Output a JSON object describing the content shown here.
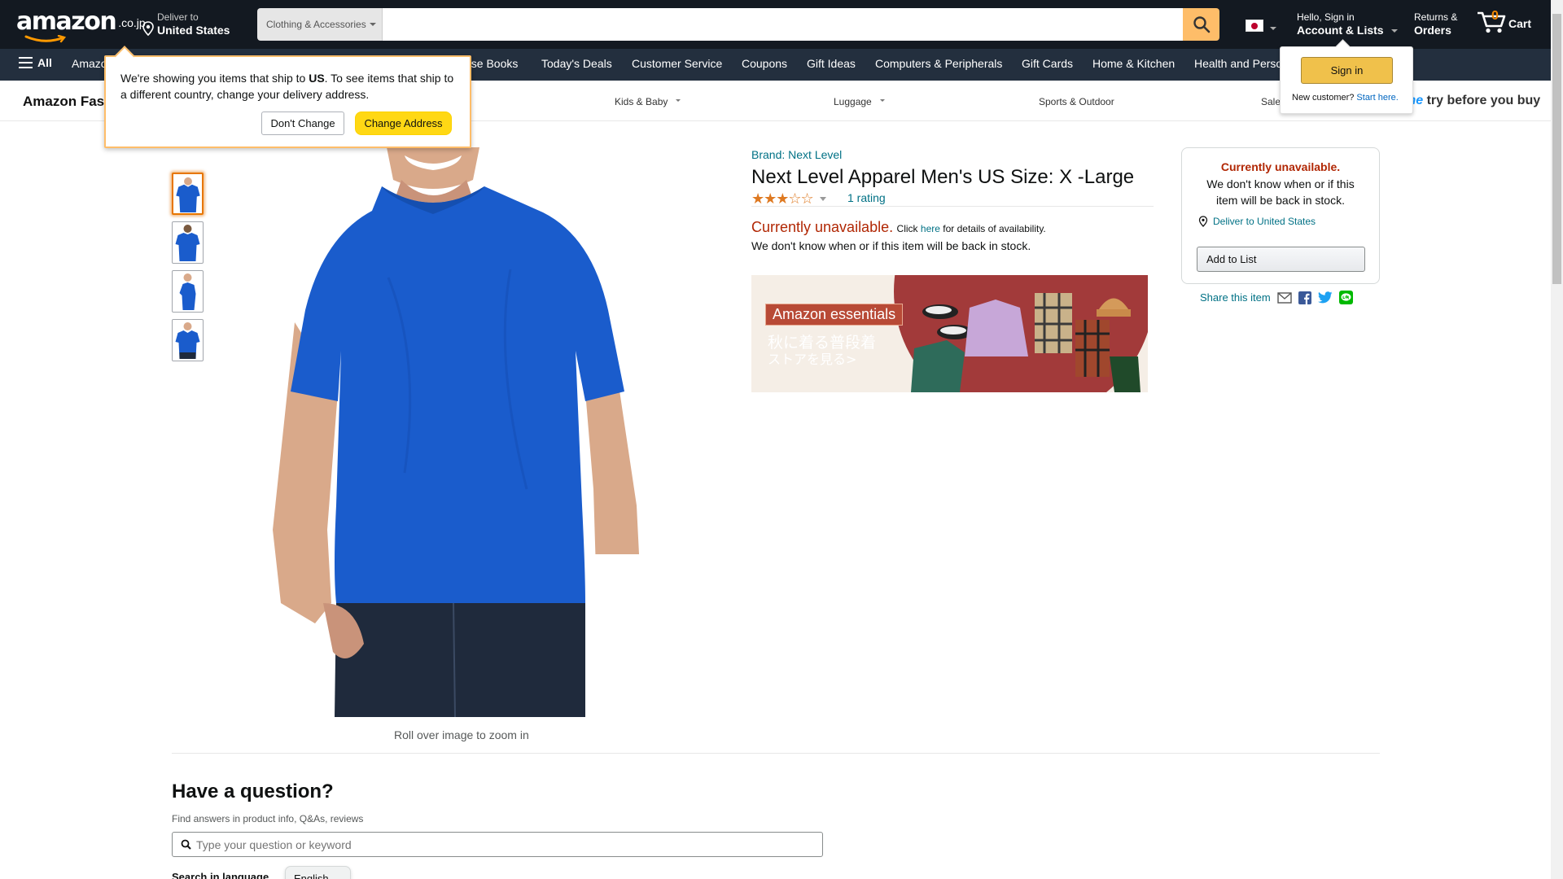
{
  "header": {
    "logo_text": "amazon",
    "logo_tld": ".co.jp",
    "deliver_label": "Deliver to",
    "deliver_location": "United States",
    "search_category": "Clothing & Accessories",
    "search_placeholder": "",
    "account_greeting": "Hello, Sign in",
    "account_label": "Account & Lists",
    "returns_line1": "Returns &",
    "returns_line2": "Orders",
    "cart_count": "0",
    "cart_label": "Cart"
  },
  "main_nav": {
    "all_label": "All",
    "items": [
      "Amazon",
      "ese Books",
      "Today's Deals",
      "Customer Service",
      "Coupons",
      "Gift Ideas",
      "Computers & Peripherals",
      "Gift Cards",
      "Home & Kitchen",
      "Health and Perso"
    ]
  },
  "fashion_nav": {
    "brand": "Amazon Fas",
    "categories": [
      "Kids & Baby",
      "Luggage",
      "Sports & Outdoor",
      "Sale"
    ],
    "try_before_prefix": "me",
    "try_before_text": " try before you buy"
  },
  "delivery_popover": {
    "message_part1": "We're showing you items that ship to ",
    "message_bold": "US",
    "message_part2": ". To see items that ship to a different country, change your delivery address.",
    "dont_change": "Don't Change",
    "change_address": "Change Address"
  },
  "signin_flyout": {
    "button": "Sign in",
    "new_customer": "New customer?",
    "start_here": "Start here."
  },
  "product": {
    "brand_link": "Brand: Next Level",
    "title": "Next Level Apparel Men's US Size: X -Large",
    "rating_value": 3,
    "rating_max": 5,
    "rating_count": "1 rating",
    "unavailable": "Currently unavailable.",
    "click": "Click ",
    "here": "here",
    "details_suffix": " for details of availability.",
    "back_in_stock": "We don't know when or if this item will be back in stock.",
    "zoom_hint": "Roll over image to zoom in",
    "shirt_color": "#1a5ccc"
  },
  "banner": {
    "tag": "Amazon essentials",
    "line1": "秋に着る普段着",
    "line2": "ストアを見る>"
  },
  "buybox": {
    "unavailable": "Currently unavailable.",
    "message": "We don't know when or if this item will be back in stock.",
    "deliver": "Deliver to United States",
    "add_to_list": "Add to List",
    "share_label": "Share this item"
  },
  "questions": {
    "heading": "Have a question?",
    "sub": "Find answers in product info, Q&As, reviews",
    "placeholder": "Type your question or keyword",
    "language_label": "Search in language",
    "language_value": "English"
  },
  "colors": {
    "nav_dark": "#131921",
    "nav_secondary": "#232f3e",
    "search_button": "#febd69",
    "link": "#007185",
    "price_red": "#b12704",
    "star": "#de7921"
  }
}
